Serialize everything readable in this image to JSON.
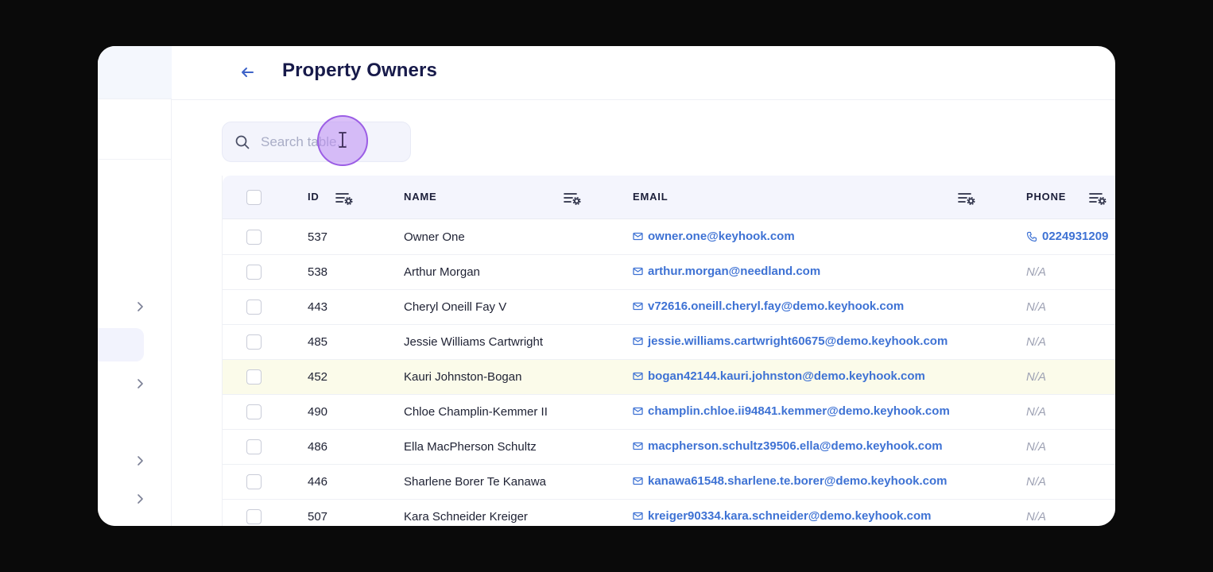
{
  "header": {
    "title": "Property Owners",
    "back_icon": "arrow-left-icon"
  },
  "search": {
    "placeholder": "Search table..."
  },
  "table": {
    "columns": [
      {
        "key": "id",
        "label": "ID"
      },
      {
        "key": "name",
        "label": "NAME"
      },
      {
        "key": "email",
        "label": "EMAIL"
      },
      {
        "key": "phone",
        "label": "PHONE"
      }
    ],
    "rows": [
      {
        "id": "537",
        "name": "Owner One",
        "email": "owner.one@keyhook.com",
        "phone": "0224931209"
      },
      {
        "id": "538",
        "name": "Arthur Morgan",
        "email": "arthur.morgan@needland.com",
        "phone": "N/A"
      },
      {
        "id": "443",
        "name": "Cheryl Oneill Fay V",
        "email": "v72616.oneill.cheryl.fay@demo.keyhook.com",
        "phone": "N/A"
      },
      {
        "id": "485",
        "name": "Jessie Williams Cartwright",
        "email": "jessie.williams.cartwright60675@demo.keyhook.com",
        "phone": "N/A"
      },
      {
        "id": "452",
        "name": "Kauri Johnston-Bogan",
        "email": "bogan42144.kauri.johnston@demo.keyhook.com",
        "phone": "N/A",
        "highlighted": true
      },
      {
        "id": "490",
        "name": "Chloe Champlin-Kemmer II",
        "email": "champlin.chloe.ii94841.kemmer@demo.keyhook.com",
        "phone": "N/A"
      },
      {
        "id": "486",
        "name": "Ella MacPherson Schultz",
        "email": "macpherson.schultz39506.ella@demo.keyhook.com",
        "phone": "N/A"
      },
      {
        "id": "446",
        "name": "Sharlene Borer Te Kanawa",
        "email": "kanawa61548.sharlene.te.borer@demo.keyhook.com",
        "phone": "N/A"
      },
      {
        "id": "507",
        "name": "Kara Schneider Kreiger",
        "email": "kreiger90334.kara.schneider@demo.keyhook.com",
        "phone": "N/A"
      }
    ]
  },
  "colors": {
    "accent": "#3e72d4",
    "title": "#171a4a",
    "highlight_row": "#fbfbea",
    "cursor": "#9b5de5"
  }
}
